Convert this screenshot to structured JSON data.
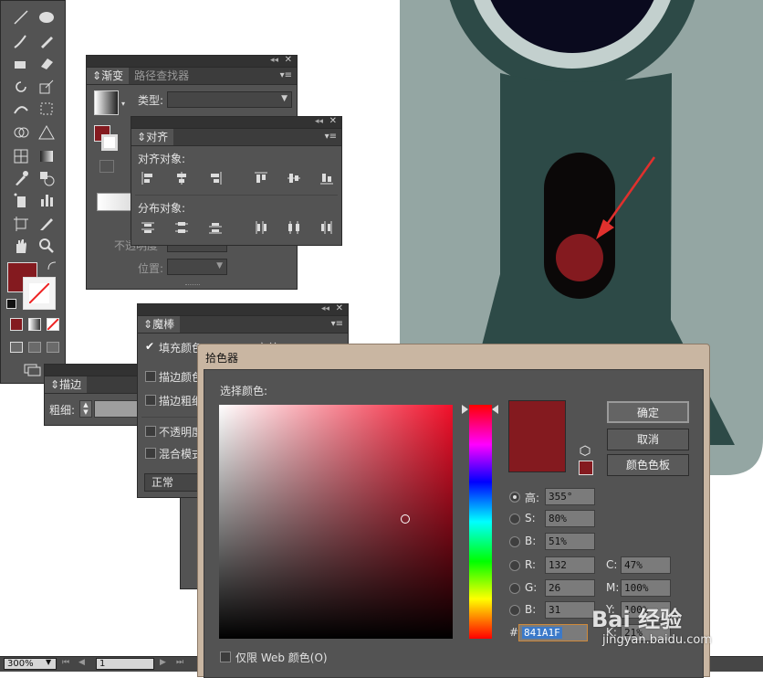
{
  "colors": {
    "accent_red": "#841A1F",
    "artboard_teal": "#2d4a47",
    "artboard_gray": "#94a6a3"
  },
  "gradient_panel": {
    "tabs": [
      "渐变",
      "路径查找器"
    ],
    "type_label": "类型:",
    "opacity_label": "不透明度",
    "position_label": "位置:"
  },
  "align_panel": {
    "tab": "对齐",
    "align_objects": "对齐对象:",
    "distribute_objects": "分布对象:"
  },
  "magic_wand_panel": {
    "tab": "魔棒",
    "fill_color": "填充颜色",
    "tolerance": "容差",
    "stroke_color": "描边颜色",
    "stroke_weight": "描边粗细",
    "opacity": "不透明度",
    "blend_mode": "混合模式",
    "blend_value": "正常"
  },
  "stroke_panel": {
    "tab": "描边",
    "weight_label": "粗细:"
  },
  "color_picker": {
    "title": "拾色器",
    "select_label": "选择颜色:",
    "ok": "确定",
    "cancel": "取消",
    "swatches": "颜色色板",
    "h_label": "高:",
    "h": "355°",
    "s_label": "S:",
    "s": "80%",
    "b_label": "B:",
    "b": "51%",
    "r_label": "R:",
    "r": "132",
    "g_label": "G:",
    "g": "26",
    "bl_label": "B:",
    "bl": "31",
    "c_label": "C:",
    "c": "47%",
    "m_label": "M:",
    "m": "100%",
    "y_label": "Y:",
    "y": "100%",
    "k_label": "K:",
    "k": "21%",
    "hash": "#",
    "hex": "841A1F",
    "web_only": "仅限 Web 颜色(O)"
  },
  "status_bar": {
    "zoom": "300%",
    "page": "1"
  },
  "watermark": {
    "brand": "Bai 经验",
    "url": "jingyan.baidu.com"
  }
}
